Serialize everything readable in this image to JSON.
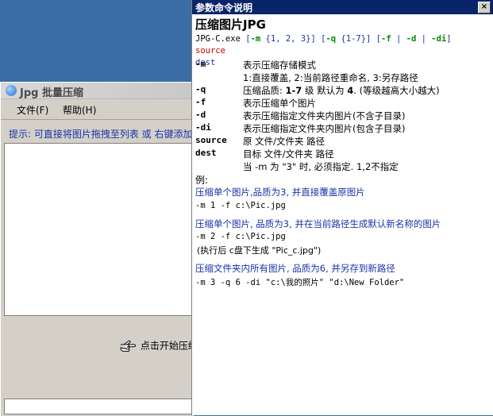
{
  "app": {
    "title": "Jpg 批量压缩",
    "menu": {
      "file": "文件(F)",
      "help": "帮助(H)"
    },
    "hint": "提示: 可直接将图片拖拽至列表 或 右键添加",
    "start_label": "点击开始压缩"
  },
  "help": {
    "window_title": "参数命令说明",
    "close_label": "×",
    "heading": "压缩图片JPG",
    "usage": {
      "exe": "JPG-C.exe",
      "m_flag": "-m",
      "m_arg": "{1, 2, 3}",
      "q_flag": "-q",
      "q_arg": "{1-7}",
      "f_flag": "-f",
      "d_flag": "-d",
      "di_flag": "-di",
      "src": "source",
      "dest": "dest"
    },
    "options": [
      {
        "name": "-m",
        "desc": "表示压缩存储模式"
      },
      {
        "name": "",
        "desc": "1:直接覆盖, 2:当前路径重命名, 3:另存路径"
      },
      {
        "name": "-q",
        "desc_pre": "压缩品质: ",
        "desc_bold": "1-7",
        "desc_mid": " 级 默认为 ",
        "desc_bold2": "4",
        "desc_post": ". (等级越高大小越大)"
      },
      {
        "name": "-f",
        "desc": "表示压缩单个图片"
      },
      {
        "name": "-d",
        "desc": "表示压缩指定文件夹内图片(不含子目录)"
      },
      {
        "name": "-di",
        "desc": "表示压缩指定文件夹内图片(包含子目录)"
      },
      {
        "name": "source",
        "desc": " 原 文件/文件夹 路径"
      },
      {
        "name": "dest",
        "desc": "目标 文件/文件夹 路径"
      },
      {
        "name": "",
        "desc": "当 -m 为 \"3\" 时, 必须指定. 1,2不指定"
      }
    ],
    "example_label": "例:",
    "examples": [
      {
        "title": "压缩单个图片,品质为3, 并直接覆盖原图片",
        "cmd": "-m 1 -f c:\\Pic.jpg",
        "note": ""
      },
      {
        "title": "压缩单个图片, 品质为3, 并在当前路径生成默认新名称的图片",
        "cmd": "-m 2 -f c:\\Pic.jpg",
        "note": "(执行后 c盘下生成 \"Pic_c.jpg\")"
      },
      {
        "title": "压缩文件夹内所有图片, 品质为6, 并另存到新路径",
        "cmd": "-m 3 -q 6 -di \"c:\\我的照片\" \"d:\\New Folder\"",
        "note": ""
      }
    ]
  }
}
